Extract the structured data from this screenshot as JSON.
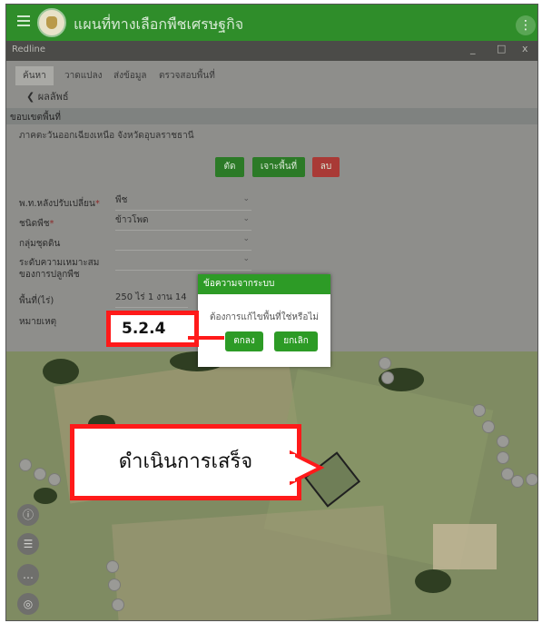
{
  "app": {
    "title": "แผนที่ทางเลือกพืชเศรษฐกิจ"
  },
  "window": {
    "title": "Redline",
    "minimize": "_",
    "maximize": "□",
    "close": "x"
  },
  "tabs": [
    {
      "label": "ค้นหา"
    },
    {
      "label": "วาดแปลง"
    },
    {
      "label": "ส่งข้อมูล"
    },
    {
      "label": "ตรวจสอบพื้นที่"
    }
  ],
  "back": {
    "label": "ผลลัพธ์"
  },
  "section": {
    "title": "ขอบเขตพื้นที่",
    "region": "ภาคตะวันออกเฉียงเหนือ จังหวัดอุบลราชธานี"
  },
  "actions": {
    "cut": "ตัด",
    "clip": "เจาะพื้นที่",
    "delete": "ลบ"
  },
  "form": {
    "plant_type_label": "พ.ท.หลังปรับเปลี่ยน",
    "plant_type_value": "พืช",
    "crop_label": "ชนิดพืช",
    "crop_value": "ข้าวโพด",
    "soil_label": "กลุ่มชุดดิน",
    "soil_value": "",
    "suitability_label": "ระดับความเหมาะสมของการปลูกพืช",
    "area_label": "พื้นที่(ไร่)",
    "area_value": "250 ไร่ 1 งาน 14 ต",
    "note_label": "หมายเหตุ",
    "required_mark": "*"
  },
  "dialog": {
    "title": "ข้อความจากระบบ",
    "message": "ต้องการแก้ไขพื้นที่ใช่หรือไม่",
    "ok": "ตกลง",
    "cancel": "ยกเลิก"
  },
  "annotations": {
    "step": "5.2.4",
    "done": "ดำเนินการเสร็จ"
  },
  "colors": {
    "accent": "#2f8d2a",
    "callout_red": "#ff1a1a",
    "delete_red": "#a93a36"
  }
}
